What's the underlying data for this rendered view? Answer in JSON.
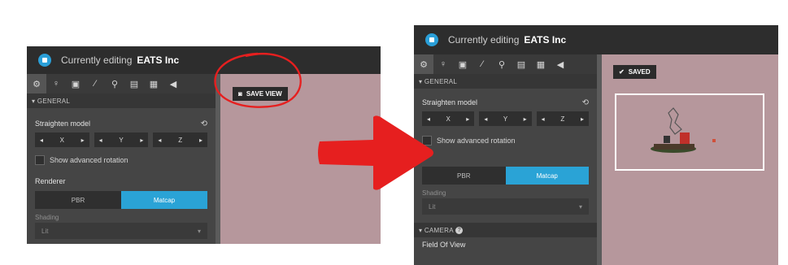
{
  "left": {
    "title_prefix": "Currently editing",
    "company": "EATS Inc",
    "section_general": "GENERAL",
    "straighten_label": "Straighten model",
    "reset_icon": "⟲",
    "axes": [
      "X",
      "Y",
      "Z"
    ],
    "advanced_rotation": "Show advanced rotation",
    "renderer_label": "Renderer",
    "renderer_options": [
      "PBR",
      "Matcap"
    ],
    "shading_label": "Shading",
    "shading_value": "Lit",
    "save_view_label": "SAVE VIEW"
  },
  "right": {
    "title_prefix": "Currently editing",
    "company": "EATS Inc",
    "section_general": "GENERAL",
    "straighten_label": "Straighten model",
    "reset_icon": "⟲",
    "axes": [
      "X",
      "Y",
      "Z"
    ],
    "advanced_rotation": "Show advanced rotation",
    "renderer_options": [
      "PBR",
      "Matcap"
    ],
    "shading_label": "Shading",
    "shading_value": "Lit",
    "camera_label": "CAMERA",
    "field_of_view_label": "Field Of View",
    "saved_label": "SAVED"
  },
  "colors": {
    "accent": "#2aa3d6",
    "viewport": "#b6979c",
    "panel": "#454545",
    "annotation_red": "#e61f1f"
  },
  "icons": [
    "settings-icon",
    "light-icon",
    "image-icon",
    "wand-icon",
    "pin-icon",
    "film-icon",
    "ar-vr-icon",
    "audio-icon"
  ]
}
